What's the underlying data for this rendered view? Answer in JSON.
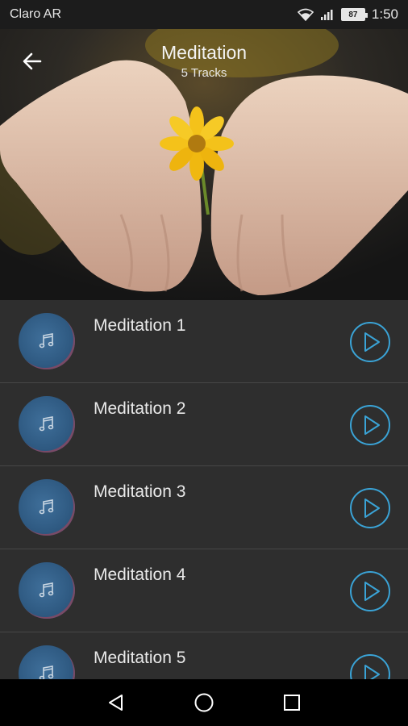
{
  "status_bar": {
    "carrier": "Claro AR",
    "battery": "87",
    "time": "1:50"
  },
  "header": {
    "title": "Meditation",
    "subtitle": "5 Tracks",
    "back_icon": "arrow-left-icon"
  },
  "tracks": [
    {
      "title": "Meditation 1"
    },
    {
      "title": "Meditation 2"
    },
    {
      "title": "Meditation 3"
    },
    {
      "title": "Meditation 4"
    },
    {
      "title": "Meditation 5"
    }
  ],
  "colors": {
    "accent": "#3aa3d6",
    "list_background": "#2e2e2e",
    "avatar_blue": "#2f5a82"
  }
}
